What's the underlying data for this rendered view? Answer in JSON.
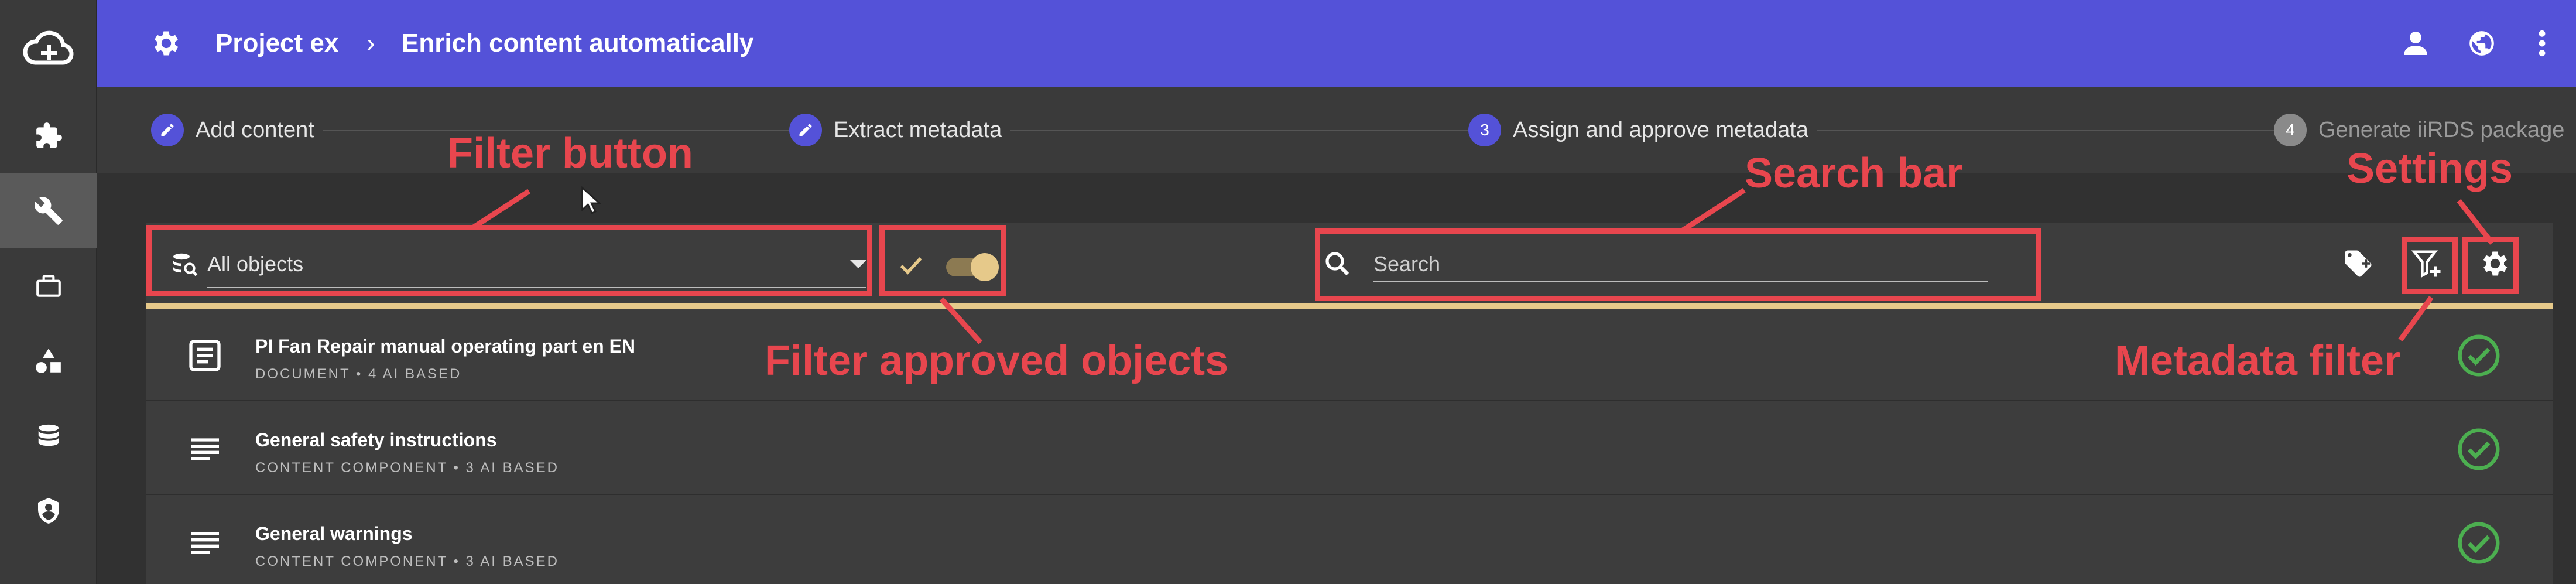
{
  "header": {
    "project": "Project ex",
    "separator": "›",
    "page_title": "Enrich content automatically"
  },
  "stepper": {
    "steps": [
      {
        "label": "Add content",
        "state": "done",
        "marker": ""
      },
      {
        "label": "Extract metadata",
        "state": "done",
        "marker": ""
      },
      {
        "label": "Assign and approve metadata",
        "state": "current",
        "marker": "3"
      },
      {
        "label": "Generate iiRDS package",
        "state": "future",
        "marker": "4"
      }
    ]
  },
  "toolbar": {
    "filter_value": "All objects",
    "search_placeholder": "Search"
  },
  "rows": [
    {
      "title": "PI Fan Repair manual operating part en EN",
      "subtitle": "DOCUMENT • 4 AI BASED",
      "icon": "document-icon"
    },
    {
      "title": "General safety instructions",
      "subtitle": "CONTENT COMPONENT • 3 AI BASED",
      "icon": "text-lines-icon"
    },
    {
      "title": "General warnings",
      "subtitle": "CONTENT COMPONENT • 3 AI BASED",
      "icon": "text-lines-icon"
    }
  ],
  "annotations": {
    "filter_button": "Filter button",
    "filter_approved": "Filter approved objects",
    "search_bar": "Search bar",
    "settings": "Settings",
    "metadata_filter": "Metadata filter"
  },
  "colors": {
    "header": "#5452d8",
    "accent_gold": "#e6c98a",
    "annotation": "#e8464e",
    "approved": "#4caf50"
  }
}
